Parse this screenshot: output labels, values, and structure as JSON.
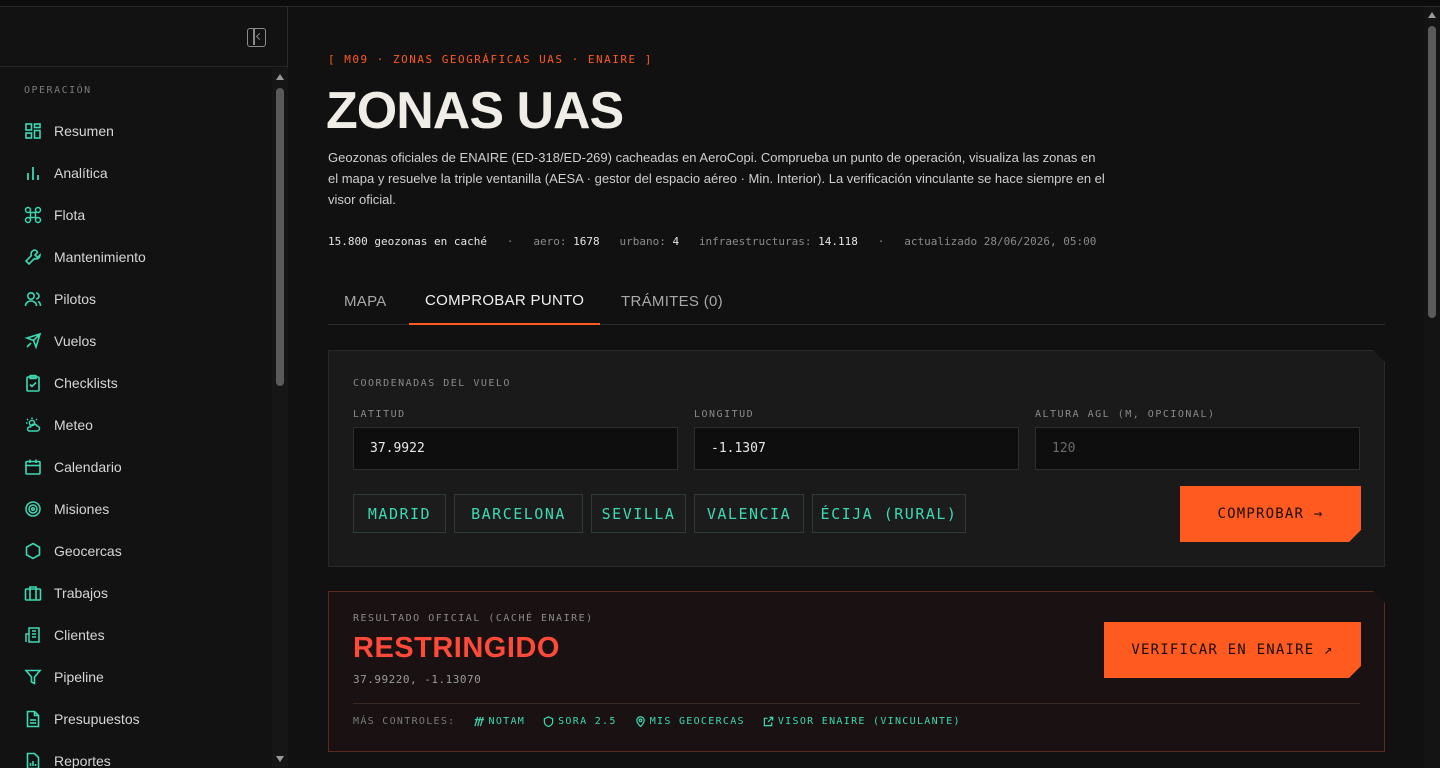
{
  "sidebar": {
    "section_label": "OPERACIÓN",
    "items": [
      {
        "label": "Resumen",
        "icon": "dashboard-icon"
      },
      {
        "label": "Analítica",
        "icon": "bar-chart-icon"
      },
      {
        "label": "Flota",
        "icon": "drone-icon"
      },
      {
        "label": "Mantenimiento",
        "icon": "wrench-icon"
      },
      {
        "label": "Pilotos",
        "icon": "users-icon"
      },
      {
        "label": "Vuelos",
        "icon": "plane-icon"
      },
      {
        "label": "Checklists",
        "icon": "clipboard-check-icon"
      },
      {
        "label": "Meteo",
        "icon": "weather-icon"
      },
      {
        "label": "Calendario",
        "icon": "calendar-icon"
      },
      {
        "label": "Misiones",
        "icon": "target-icon"
      },
      {
        "label": "Geocercas",
        "icon": "hexagon-icon"
      },
      {
        "label": "Trabajos",
        "icon": "briefcase-icon"
      },
      {
        "label": "Clientes",
        "icon": "building-icon"
      },
      {
        "label": "Pipeline",
        "icon": "funnel-icon"
      },
      {
        "label": "Presupuestos",
        "icon": "document-icon"
      },
      {
        "label": "Reportes",
        "icon": "report-icon"
      }
    ]
  },
  "header": {
    "eyebrow": "[ M09 · ZONAS GEOGRÁFICAS UAS · ENAIRE ]",
    "title": "ZONAS UAS",
    "description": "Geozonas oficiales de ENAIRE (ED-318/ED-269) cacheadas en AeroCopi. Comprueba un punto de operación, visualiza las zonas en el mapa y resuelve la triple ventanilla (AESA · gestor del espacio aéreo · Min. Interior). La verificación vinculante se hace siempre en el visor oficial."
  },
  "stats": {
    "cached": "15.800 geozonas en caché",
    "sep": "·",
    "aero_label": "aero:",
    "aero_value": "1678",
    "urbano_label": "urbano:",
    "urbano_value": "4",
    "infra_label": "infraestructuras:",
    "infra_value": "14.118",
    "updated": "actualizado 28/06/2026, 05:00"
  },
  "tabs": [
    {
      "label": "MAPA",
      "active": false
    },
    {
      "label": "COMPROBAR PUNTO",
      "active": true
    },
    {
      "label": "TRÁMITES (0)",
      "active": false
    }
  ],
  "form": {
    "section_label": "COORDENADAS DEL VUELO",
    "lat_label": "LATITUD",
    "lat_value": "37.9922",
    "lon_label": "LONGITUD",
    "lon_value": "-1.1307",
    "alt_label": "ALTURA AGL (M, OPCIONAL)",
    "alt_placeholder": "120",
    "presets": [
      "MADRID",
      "BARCELONA",
      "SEVILLA",
      "VALENCIA",
      "ÉCIJA (RURAL)"
    ],
    "submit_label": "COMPROBAR →"
  },
  "result": {
    "label": "RESULTADO OFICIAL (CACHÉ ENAIRE)",
    "status": "RESTRINGIDO",
    "coords": "37.99220, -1.13070",
    "verify_label": "VERIFICAR EN ENAIRE ↗",
    "controls_label": "MÁS CONTROLES:",
    "controls": [
      {
        "label": "NOTAM",
        "icon": "signal-icon"
      },
      {
        "label": "SORA 2.5",
        "icon": "shield-icon"
      },
      {
        "label": "MIS GEOCERCAS",
        "icon": "map-pin-icon"
      },
      {
        "label": "VISOR ENAIRE (VINCULANTE)",
        "icon": "external-link-icon"
      }
    ]
  },
  "colors": {
    "accent": "#ff5a1f",
    "teal": "#3dd9b3",
    "danger": "#ff4a3a",
    "background": "#101010"
  }
}
